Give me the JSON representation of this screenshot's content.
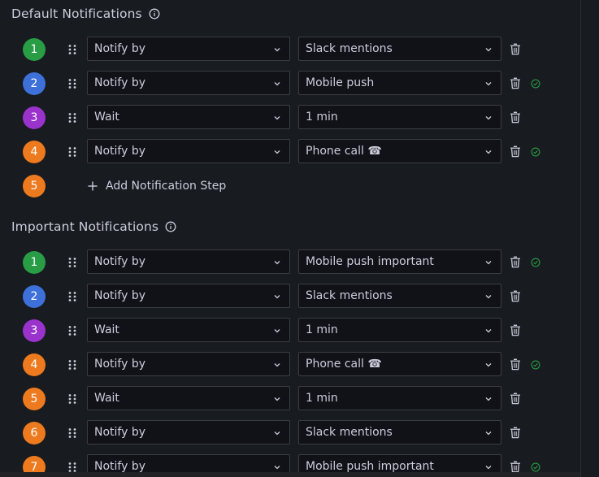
{
  "colors": {
    "green": "#299c46",
    "blue": "#3d71d9",
    "purple": "#9933cc",
    "orange": "#ed7a1e"
  },
  "icons": {
    "info": "info-circle-icon",
    "drag": "drag-handle-icon",
    "chevron": "chevron-down-icon",
    "trash": "trash-icon",
    "check": "check-circle-icon",
    "plus": "plus-icon"
  },
  "default_section": {
    "title": "Default Notifications",
    "steps": [
      {
        "num": "1",
        "color": "green",
        "action": "Notify by",
        "target": "Slack mentions",
        "verified": false
      },
      {
        "num": "2",
        "color": "blue",
        "action": "Notify by",
        "target": "Mobile push",
        "verified": true
      },
      {
        "num": "3",
        "color": "purple",
        "action": "Wait",
        "target": "1 min",
        "verified": false
      },
      {
        "num": "4",
        "color": "orange",
        "action": "Notify by",
        "target": "Phone call ☎",
        "verified": true
      }
    ],
    "add_step": {
      "num": "5",
      "color": "orange",
      "label": "Add Notification Step"
    }
  },
  "important_section": {
    "title": "Important Notifications",
    "steps": [
      {
        "num": "1",
        "color": "green",
        "action": "Notify by",
        "target": "Mobile push important",
        "verified": true
      },
      {
        "num": "2",
        "color": "blue",
        "action": "Notify by",
        "target": "Slack mentions",
        "verified": false
      },
      {
        "num": "3",
        "color": "purple",
        "action": "Wait",
        "target": "1 min",
        "verified": false
      },
      {
        "num": "4",
        "color": "orange",
        "action": "Notify by",
        "target": "Phone call ☎",
        "verified": true
      },
      {
        "num": "5",
        "color": "orange",
        "action": "Wait",
        "target": "1 min",
        "verified": false
      },
      {
        "num": "6",
        "color": "orange",
        "action": "Notify by",
        "target": "Slack mentions",
        "verified": false
      },
      {
        "num": "7",
        "color": "orange",
        "action": "Notify by",
        "target": "Mobile push important",
        "verified": true
      }
    ]
  }
}
